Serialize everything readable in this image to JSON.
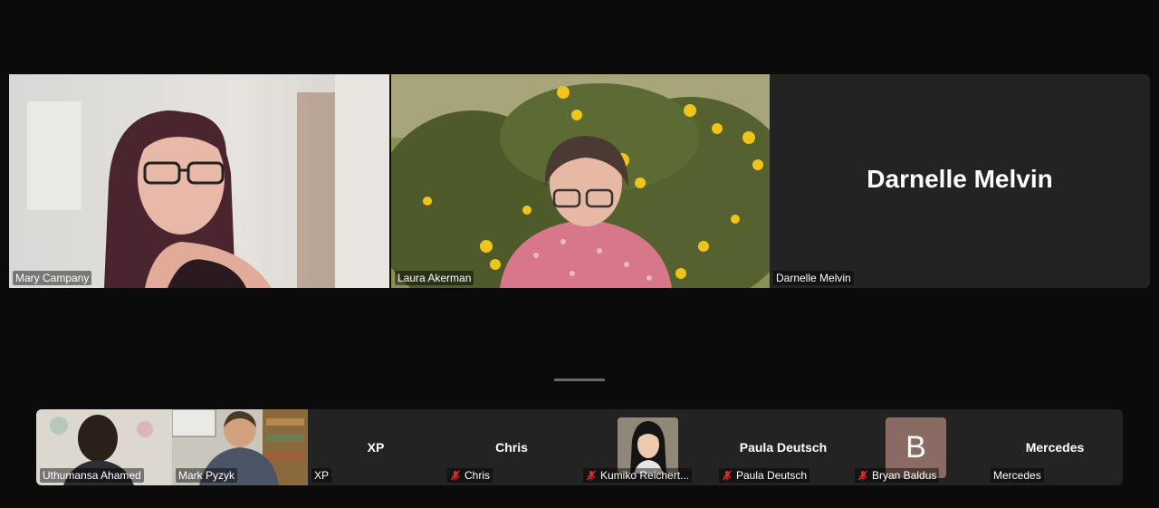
{
  "gallery": {
    "main": [
      {
        "name": "Mary Campany",
        "active": true,
        "video": true
      },
      {
        "name": "Laura Akerman",
        "active": false,
        "video": true
      },
      {
        "name": "Darnelle Melvin",
        "display_name": "Darnelle Melvin",
        "active": false,
        "video": false
      }
    ],
    "strip": [
      {
        "name": "Uthumansa Ahamed",
        "video": true,
        "muted": false
      },
      {
        "name": "Mark Pyzyk",
        "video": true,
        "muted": false
      },
      {
        "name": "XP",
        "display_name": "XP",
        "video": false,
        "muted": false
      },
      {
        "name": "Chris",
        "display_name": "Chris",
        "video": false,
        "muted": true
      },
      {
        "name": "Kumiko Reichert...",
        "video": false,
        "photo": true,
        "muted": true
      },
      {
        "name": "Paula Deutsch",
        "display_name": "Paula Deutsch",
        "video": false,
        "muted": true
      },
      {
        "name": "Bryan Baldus",
        "avatar_letter": "B",
        "video": false,
        "muted": true
      },
      {
        "name": "Mercedes",
        "display_name": "Mercedes",
        "video": false,
        "muted": false
      }
    ]
  },
  "colors": {
    "background": "#0b0b0b",
    "tile": "#232323",
    "active_speaker_border": "#23d18b",
    "mic_off": "#e02828",
    "avatar_bg": "#8a6b63"
  }
}
